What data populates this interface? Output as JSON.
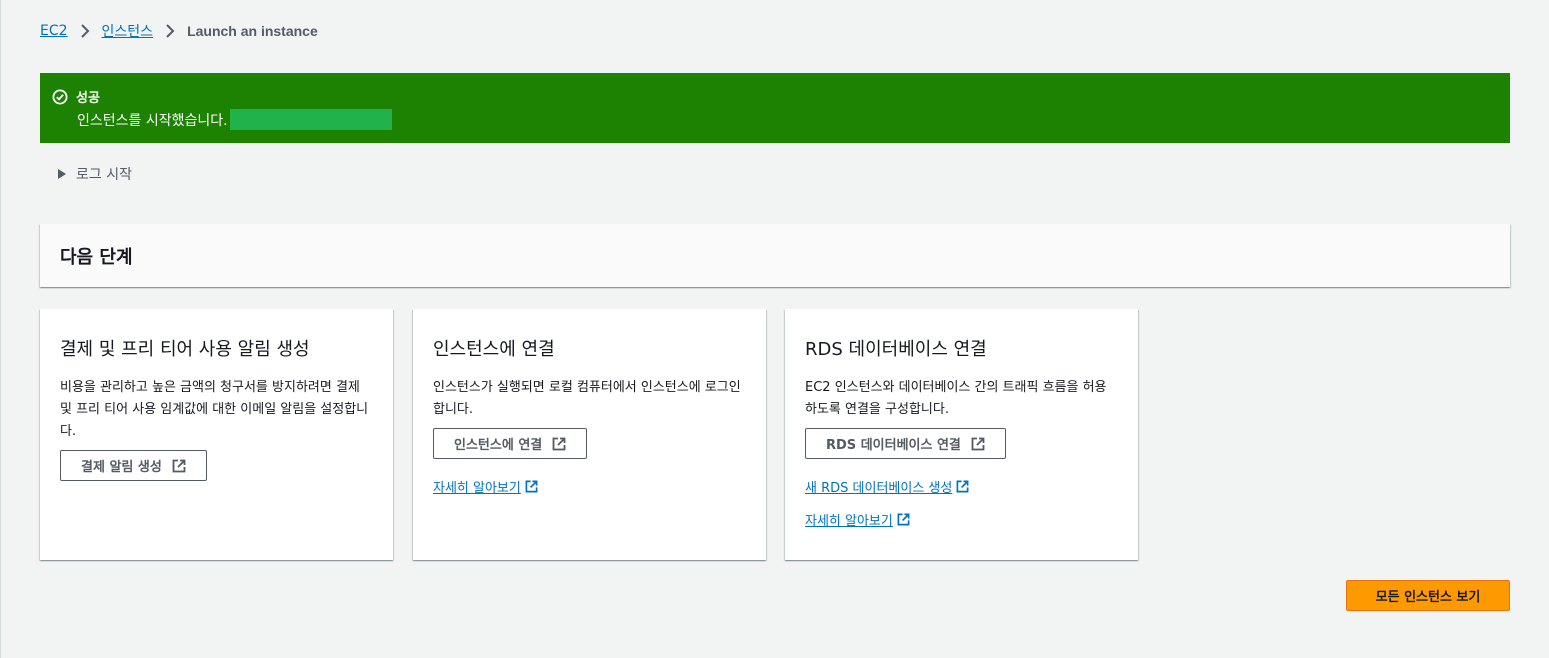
{
  "breadcrumb": {
    "items": [
      "EC2",
      "인스턴스"
    ],
    "current": "Launch an instance"
  },
  "flash": {
    "title": "성공",
    "message": "인스턴스를 시작했습니다."
  },
  "log": {
    "label": "로그 시작"
  },
  "next_steps": {
    "title": "다음 단계"
  },
  "cards": [
    {
      "title": "결제 및 프리 티어 사용 알림 생성",
      "description": "비용을 관리하고 높은 금액의 청구서를 방지하려면 결제 및 프리 티어 사용 임계값에 대한 이메일 알림을 설정합니다.",
      "button": "결제 알림 생성"
    },
    {
      "title": "인스턴스에 연결",
      "description": "인스턴스가 실행되면 로컬 컴퓨터에서 인스턴스에 로그인합니다.",
      "button": "인스턴스에 연결",
      "links": [
        "자세히 알아보기"
      ]
    },
    {
      "title": "RDS 데이터베이스 연결",
      "description": "EC2 인스턴스와 데이터베이스 간의 트래픽 흐름을 허용하도록 연결을 구성합니다.",
      "button": "RDS 데이터베이스 연결",
      "links": [
        "새 RDS 데이터베이스 생성",
        "자세히 알아보기"
      ]
    }
  ],
  "footer": {
    "view_all_button": "모든 인스턴스 보기"
  },
  "colors": {
    "success": "#1d8102",
    "link": "#0073bb",
    "primary": "#ff9900",
    "background": "#f2f3f3"
  }
}
